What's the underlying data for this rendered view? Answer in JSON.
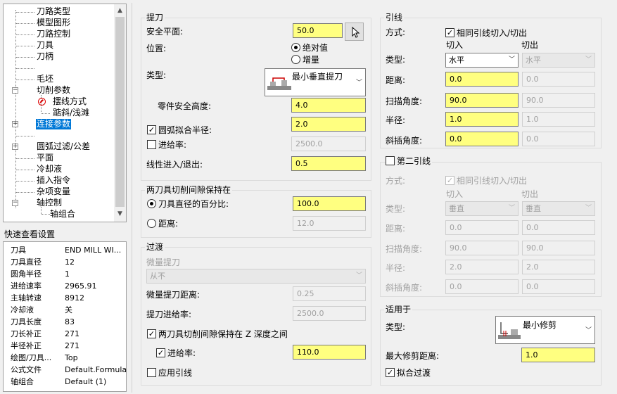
{
  "tree": {
    "items": [
      "刀路类型",
      "模型图形",
      "刀路控制",
      "刀具",
      "刀柄",
      "",
      "毛坯",
      "切削参数",
      "摆线方式",
      "踮斜/浅滩",
      "连接参数",
      "",
      "圆弧过滤/公差",
      "平面",
      "冷却液",
      "插入指令",
      "杂项变量",
      "轴控制",
      "轴组合"
    ]
  },
  "quick_view": {
    "title": "快速查看设置",
    "rows": [
      {
        "k": "刀具",
        "v": "END MILL WI..."
      },
      {
        "k": "刀具直径",
        "v": "12"
      },
      {
        "k": "圆角半径",
        "v": "1"
      },
      {
        "k": "进给速率",
        "v": "2965.91"
      },
      {
        "k": "主轴转速",
        "v": "8912"
      },
      {
        "k": "冷却液",
        "v": "关"
      },
      {
        "k": "刀具长度",
        "v": "83"
      },
      {
        "k": "刀长补正",
        "v": "271"
      },
      {
        "k": "半径补正",
        "v": "271"
      },
      {
        "k": "绘图/刀具...",
        "v": "Top"
      },
      {
        "k": "公式文件",
        "v": "Default.Formula"
      },
      {
        "k": "轴组合",
        "v": "Default (1)"
      }
    ]
  },
  "retract": {
    "title": "提刀",
    "safe_plane_label": "安全平面:",
    "safe_plane": "50.0",
    "position_label": "位置:",
    "absolute": "绝对值",
    "incremental": "增量",
    "type_label": "类型:",
    "type_value": "最小垂直提刀",
    "part_safe_height_label": "零件安全高度:",
    "part_safe_height": "4.0",
    "arc_fit_label": "圆弧拟合半径:",
    "arc_fit": "2.0",
    "feed_label": "进给率:",
    "feed": "2500.0",
    "linear_label": "线性进入/退出:",
    "linear": "0.5"
  },
  "gap": {
    "title": "两刀具切削间隙保持在",
    "percent_label": "刀具直径的百分比:",
    "percent": "100.0",
    "distance_label": "距离:",
    "distance": "12.0"
  },
  "transition": {
    "title": "过渡",
    "micro_label": "微量提刀",
    "micro_value": "从不",
    "micro_dist_label": "微量提刀距离:",
    "micro_dist": "0.25",
    "feed_label": "提刀进给率:",
    "feed": "2500.0",
    "keep_gap_label": "两刀具切削间隙保持在 Z 深度之间",
    "feed2_label": "进给率:",
    "feed2": "110.0",
    "apply_lead_label": "应用引线"
  },
  "lead": {
    "title": "引线",
    "mode_label": "方式:",
    "same_label": "相同引线切入/切出",
    "in": "切入",
    "out": "切出",
    "type_label": "类型:",
    "type_in": "水平",
    "type_out": "水平",
    "distance_label": "距离:",
    "distance_in": "0.0",
    "distance_out": "0.0",
    "sweep_label": "扫描角度:",
    "sweep_in": "90.0",
    "sweep_out": "90.0",
    "radius_label": "半径:",
    "radius_in": "1.0",
    "radius_out": "1.0",
    "ramp_label": "斜插角度:",
    "ramp_in": "0.0",
    "ramp_out": "0.0"
  },
  "lead2": {
    "title": "第二引线",
    "mode_label": "方式:",
    "same_label": "相同引线切入/切出",
    "in": "切入",
    "out": "切出",
    "type_label": "类型:",
    "type_in": "垂直",
    "type_out": "垂直",
    "distance_label": "距离:",
    "distance_in": "0.0",
    "distance_out": "0.0",
    "sweep_label": "扫描角度:",
    "sweep_in": "90.0",
    "sweep_out": "90.0",
    "radius_label": "半径:",
    "radius_in": "2.0",
    "radius_out": "2.0",
    "ramp_label": "斜插角度:",
    "ramp_in": "0.0",
    "ramp_out": "0.0"
  },
  "apply": {
    "title": "适用于",
    "type_label": "类型:",
    "type_value": "最小修剪",
    "max_trim_label": "最大修剪距离:",
    "max_trim": "1.0",
    "fit_label": "拟合过渡"
  }
}
